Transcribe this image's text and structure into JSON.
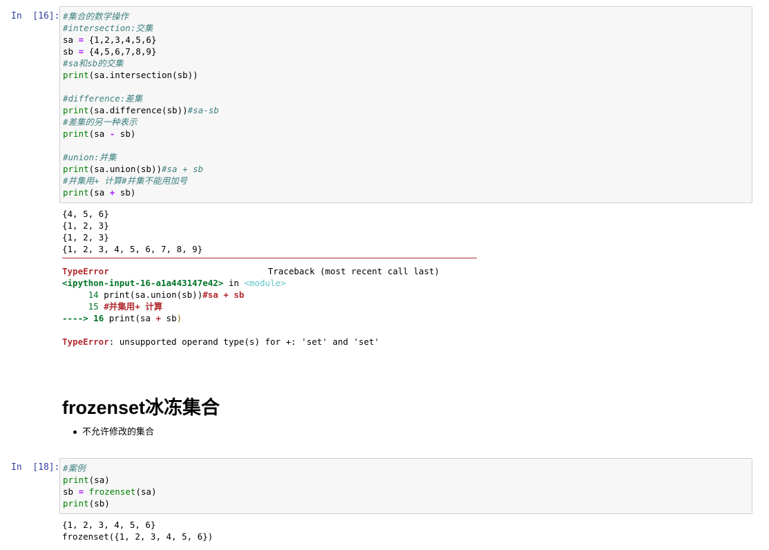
{
  "cell16": {
    "prompt": "In  [16]:",
    "code_lines": [
      [
        {
          "t": "#集合的数学操作",
          "c": "cm"
        }
      ],
      [
        {
          "t": "#intersection:交集",
          "c": "cm"
        }
      ],
      [
        {
          "t": "sa ",
          "c": ""
        },
        {
          "t": "=",
          "c": "op"
        },
        {
          "t": " {1,2,3,4,5,6}",
          "c": ""
        }
      ],
      [
        {
          "t": "sb ",
          "c": ""
        },
        {
          "t": "=",
          "c": "op"
        },
        {
          "t": " {4,5,6,7,8,9}",
          "c": ""
        }
      ],
      [
        {
          "t": "#sa和sb的交集",
          "c": "cm"
        }
      ],
      [
        {
          "t": "print",
          "c": "kw"
        },
        {
          "t": "(sa.intersection(sb))",
          "c": ""
        }
      ],
      [],
      [
        {
          "t": "#difference:差集",
          "c": "cm"
        }
      ],
      [
        {
          "t": "print",
          "c": "kw"
        },
        {
          "t": "(sa.difference(sb))",
          "c": ""
        },
        {
          "t": "#sa-sb",
          "c": "cm"
        }
      ],
      [
        {
          "t": "#差集的另一种表示",
          "c": "cm"
        }
      ],
      [
        {
          "t": "print",
          "c": "kw"
        },
        {
          "t": "(sa ",
          "c": ""
        },
        {
          "t": "-",
          "c": "op"
        },
        {
          "t": " sb)",
          "c": ""
        }
      ],
      [],
      [
        {
          "t": "#union:并集",
          "c": "cm"
        }
      ],
      [
        {
          "t": "print",
          "c": "kw"
        },
        {
          "t": "(sa.union(sb))",
          "c": ""
        },
        {
          "t": "#sa + sb",
          "c": "cm"
        }
      ],
      [
        {
          "t": "#并集用+ 计算#并集不能用加号",
          "c": "cm"
        }
      ],
      [
        {
          "t": "print",
          "c": "kw"
        },
        {
          "t": "(sa ",
          "c": ""
        },
        {
          "t": "+",
          "c": "op"
        },
        {
          "t": " sb)",
          "c": ""
        }
      ]
    ],
    "output_lines": [
      "{4, 5, 6}",
      "{1, 2, 3}",
      "{1, 2, 3}",
      "{1, 2, 3, 4, 5, 6, 7, 8, 9}"
    ],
    "traceback": {
      "error_name": "TypeError",
      "header_right": "Traceback (most recent call last)",
      "file_ref": "<ipython-input-16-a1a443147e42>",
      "in_word": " in ",
      "module": "<module>",
      "line14_num": "14",
      "line14_code": "print(sa.union(sb))",
      "line14_comment": "#sa + sb",
      "line15_num": "15",
      "line15_comment": "#并集用+ 计算",
      "arrow": "---->",
      "line16_num": "16",
      "line16_code_a": "print(sa ",
      "line16_op": "+",
      "line16_code_b": " sb",
      "line16_close": ")",
      "message_name": "TypeError",
      "message_text": ": unsupported operand type(s) for +: 'set' and 'set'"
    }
  },
  "markdown": {
    "heading": "frozenset冰冻集合",
    "bullets": [
      "不允许修改的集合"
    ]
  },
  "cell18": {
    "prompt": "In  [18]:",
    "code_lines": [
      [
        {
          "t": "#案例",
          "c": "cm"
        }
      ],
      [
        {
          "t": "print",
          "c": "kw"
        },
        {
          "t": "(sa)",
          "c": ""
        }
      ],
      [
        {
          "t": "sb ",
          "c": ""
        },
        {
          "t": "=",
          "c": "op"
        },
        {
          "t": " ",
          "c": ""
        },
        {
          "t": "frozenset",
          "c": "kw"
        },
        {
          "t": "(sa)",
          "c": ""
        }
      ],
      [
        {
          "t": "print",
          "c": "kw"
        },
        {
          "t": "(sb)",
          "c": ""
        }
      ]
    ],
    "output_lines": [
      "{1, 2, 3, 4, 5, 6}",
      "frozenset({1, 2, 3, 4, 5, 6})"
    ]
  },
  "colors": {
    "prompt": "#303f9f",
    "comment": "#408080",
    "keyword": "#008000",
    "operator": "#aa22ff",
    "error": "#b22b31",
    "cell_bg": "#f7f7f7"
  }
}
